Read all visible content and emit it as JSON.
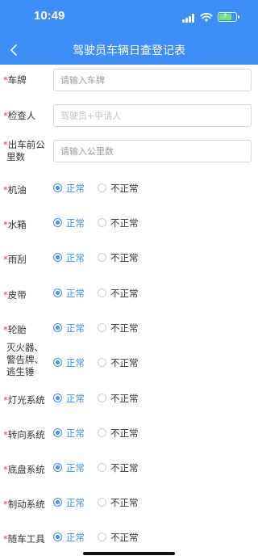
{
  "status": {
    "time": "10:49"
  },
  "header": {
    "title": "驾驶员车辆日查登记表"
  },
  "colors": {
    "primary": "#3e8ef7",
    "required": "#e4393c"
  },
  "icons": {
    "back": "chevron-left-icon",
    "signal": "signal-icon",
    "wifi": "wifi-icon",
    "battery": "battery-charging-icon"
  },
  "fields": {
    "plate": {
      "label": "车牌",
      "placeholder": "请输入车牌",
      "value": ""
    },
    "inspector": {
      "label": "检查人",
      "placeholder": "驾驶员+申请人",
      "value": ""
    },
    "mileage": {
      "label_line1": "出车前公",
      "label_line2": "里数",
      "placeholder": "请输入公里数",
      "value": ""
    }
  },
  "radio_options": {
    "normal": "正常",
    "abnormal": "不正常"
  },
  "checks": [
    {
      "label": "机油",
      "selected": "正常"
    },
    {
      "label": "水箱",
      "selected": "正常"
    },
    {
      "label": "雨刮",
      "selected": "正常"
    },
    {
      "label": "皮带",
      "selected": "正常"
    },
    {
      "label": "轮胎",
      "selected": "正常"
    },
    {
      "label": "灭火器、警告牌、逃生锤",
      "label_line1": "灭火器、",
      "label_line2": "警告牌、",
      "label_line3": "逃生锤",
      "selected": "正常"
    },
    {
      "label": "灯光系统",
      "selected": "正常"
    },
    {
      "label": "转向系统",
      "selected": "正常"
    },
    {
      "label": "底盘系统",
      "selected": "正常"
    },
    {
      "label": "制动系统",
      "selected": "正常"
    },
    {
      "label": "随车工具",
      "selected": "正常"
    }
  ]
}
